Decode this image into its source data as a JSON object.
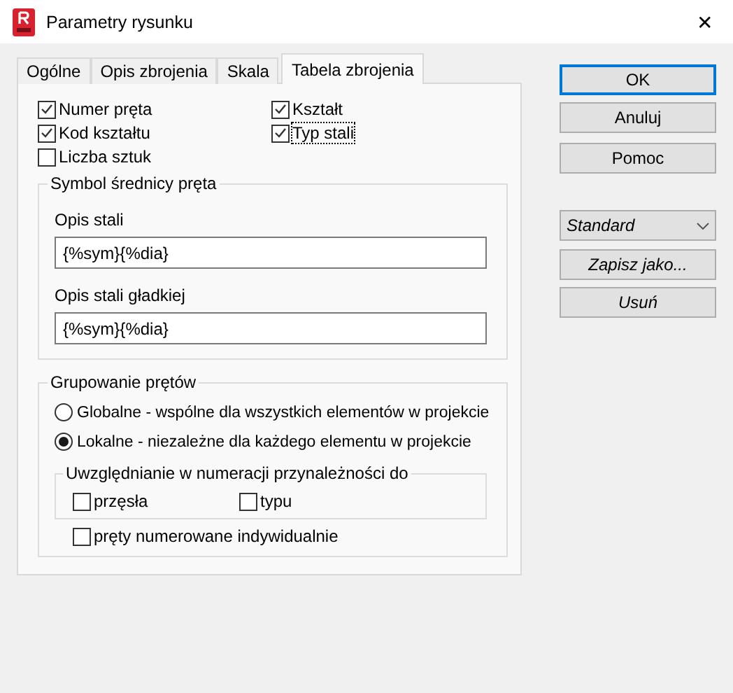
{
  "window": {
    "title": "Parametry rysunku",
    "close": "✕"
  },
  "tabs": [
    {
      "label": "Ogólne",
      "selected": false
    },
    {
      "label": "Opis zbrojenia",
      "selected": false
    },
    {
      "label": "Skala",
      "selected": false
    },
    {
      "label": "Tabela zbrojenia",
      "selected": true
    }
  ],
  "columns": [
    {
      "label": "Numer pręta",
      "checked": true,
      "focused": false
    },
    {
      "label": "Kształt",
      "checked": true,
      "focused": false
    },
    {
      "label": "Kod kształtu",
      "checked": true,
      "focused": false
    },
    {
      "label": "Typ stali",
      "checked": true,
      "focused": true
    },
    {
      "label": "Liczba sztuk",
      "checked": false,
      "focused": false
    }
  ],
  "diameter_symbol": {
    "title": "Symbol średnicy pręta",
    "fields": [
      {
        "label": "Opis stali",
        "value": "{%sym}{%dia}"
      },
      {
        "label": "Opis stali gładkiej",
        "value": "{%sym}{%dia}"
      }
    ]
  },
  "grouping": {
    "title": "Grupowanie prętów",
    "options": [
      {
        "label": "Globalne - wspólne dla wszystkich elementów w projekcie",
        "selected": false
      },
      {
        "label": "Lokalne - niezależne dla każdego elementu w projekcie",
        "selected": true
      }
    ],
    "membership": {
      "title": "Uwzględnianie w numeracji przynależności do",
      "items": [
        {
          "label": "przęsła",
          "checked": false
        },
        {
          "label": "typu",
          "checked": false
        }
      ]
    },
    "individual": {
      "label": "pręty numerowane indywidualnie",
      "checked": false
    }
  },
  "buttons": [
    {
      "label": "OK",
      "default": true
    },
    {
      "label": "Anuluj",
      "default": false
    },
    {
      "label": "Pomoc",
      "default": false
    }
  ],
  "style": {
    "value": "Standard",
    "buttons": [
      "Zapisz jako...",
      "Usuń"
    ]
  }
}
